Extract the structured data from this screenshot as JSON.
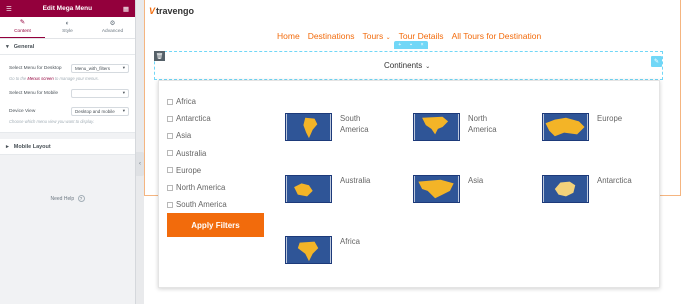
{
  "panel": {
    "title": "Edit Mega Menu",
    "tabs": [
      {
        "label": "Content",
        "icon": "pencil-icon"
      },
      {
        "label": "Style",
        "icon": "circle-half-icon"
      },
      {
        "label": "Advanced",
        "icon": "gear-icon"
      }
    ],
    "general": {
      "heading": "General",
      "desktop_label": "Select Menu for Desktop",
      "desktop_value": "Menu_with_filters",
      "menus_note_prefix": "Go to the",
      "menus_link": "Menus screen",
      "menus_note_suffix": "to manage your menus.",
      "mobile_label": "Select Menu for Mobile",
      "mobile_value": "",
      "view_label": "Device View",
      "view_value": "Desktop and mobile",
      "view_note": "Choose which menu view you want to display."
    },
    "mobile_layout": {
      "heading": "Mobile Layout"
    },
    "help": "Need Help"
  },
  "site": {
    "logo": "travengo",
    "nav": [
      "Home",
      "Destinations",
      "Tours",
      "Tour Details",
      "All Tours for Destination"
    ],
    "menu_toggle": "Continents",
    "filters": [
      "Africa",
      "Antarctica",
      "Asia",
      "Australia",
      "Europe",
      "North America",
      "South America"
    ],
    "apply_button": "Apply Filters",
    "destinations": [
      {
        "label": "South\nAmerica",
        "region": "south-america"
      },
      {
        "label": "North\nAmerica",
        "region": "north-america"
      },
      {
        "label": "Europe",
        "region": "europe"
      },
      {
        "label": "Australia",
        "region": "australia"
      },
      {
        "label": "Asia",
        "region": "asia"
      },
      {
        "label": "Antarctica",
        "region": "antarctica"
      },
      {
        "label": "Africa",
        "region": "africa"
      }
    ]
  },
  "colors": {
    "brand_orange": "#f26b0c",
    "panel_header": "#93003c",
    "editor_accent": "#71d7f7",
    "map_ocean": "#2f5597",
    "map_land": "#f3b427"
  }
}
